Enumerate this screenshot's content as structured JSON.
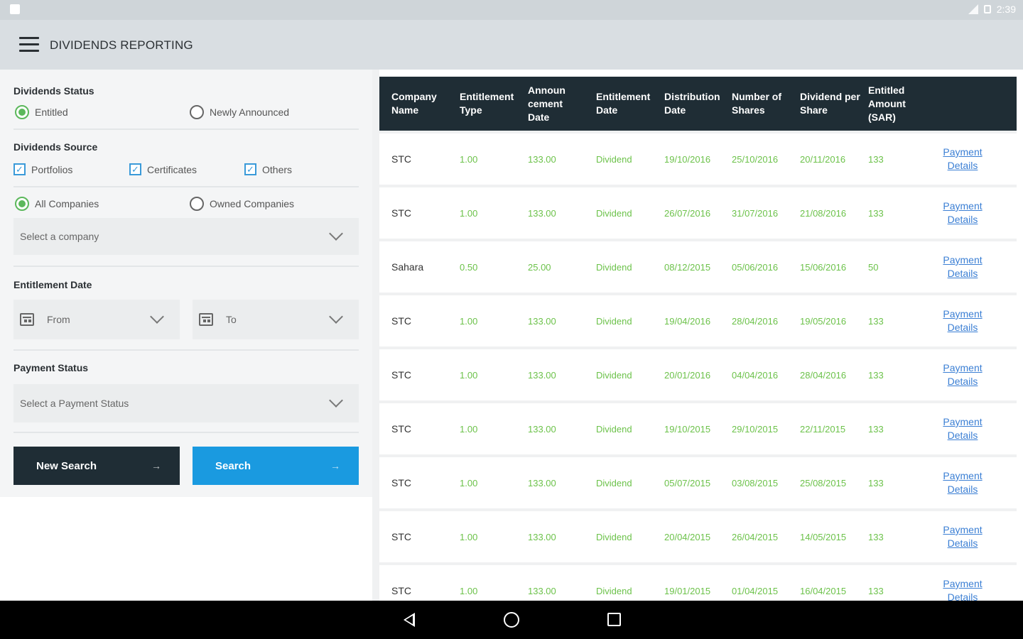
{
  "status_bar": {
    "time": "2:39"
  },
  "app_bar": {
    "title": "DIVIDENDS REPORTING"
  },
  "filters": {
    "dividends_status": {
      "title": "Dividends Status",
      "options": [
        {
          "label": "Entitled",
          "selected": true
        },
        {
          "label": "Newly Announced",
          "selected": false
        }
      ]
    },
    "dividends_source": {
      "title": "Dividends Source",
      "options": [
        {
          "label": "Portfolios",
          "checked": true
        },
        {
          "label": "Certificates",
          "checked": true
        },
        {
          "label": "Others",
          "checked": true
        }
      ]
    },
    "companies": {
      "options": [
        {
          "label": "All Companies",
          "selected": true
        },
        {
          "label": "Owned Companies",
          "selected": false
        }
      ],
      "select_placeholder": "Select a company"
    },
    "entitlement_date": {
      "title": "Entitlement Date",
      "from_placeholder": "From",
      "to_placeholder": "To"
    },
    "payment_status": {
      "title": "Payment Status",
      "select_placeholder": "Select a Payment Status"
    },
    "buttons": {
      "new_search": "New Search",
      "search": "Search",
      "arrow": "→"
    }
  },
  "table": {
    "columns": [
      "Company Name",
      "Entitlement Type",
      "Announ cement Date",
      "Entitlement Date",
      "Distribution Date",
      "Number of Shares",
      "Dividend per Share",
      "Entitled Amount (SAR)"
    ],
    "link_line1": "Payment",
    "link_line2": "Details",
    "rows": [
      [
        "STC",
        "1.00",
        "133.00",
        "Dividend",
        "19/10/2016",
        "25/10/2016",
        "20/11/2016",
        "133"
      ],
      [
        "STC",
        "1.00",
        "133.00",
        "Dividend",
        "26/07/2016",
        "31/07/2016",
        "21/08/2016",
        "133"
      ],
      [
        "Sahara",
        "0.50",
        "25.00",
        "Dividend",
        "08/12/2015",
        "05/06/2016",
        "15/06/2016",
        "50"
      ],
      [
        "STC",
        "1.00",
        "133.00",
        "Dividend",
        "19/04/2016",
        "28/04/2016",
        "19/05/2016",
        "133"
      ],
      [
        "STC",
        "1.00",
        "133.00",
        "Dividend",
        "20/01/2016",
        "04/04/2016",
        "28/04/2016",
        "133"
      ],
      [
        "STC",
        "1.00",
        "133.00",
        "Dividend",
        "19/10/2015",
        "29/10/2015",
        "22/11/2015",
        "133"
      ],
      [
        "STC",
        "1.00",
        "133.00",
        "Dividend",
        "05/07/2015",
        "03/08/2015",
        "25/08/2015",
        "133"
      ],
      [
        "STC",
        "1.00",
        "133.00",
        "Dividend",
        "20/04/2015",
        "26/04/2015",
        "14/05/2015",
        "133"
      ],
      [
        "STC",
        "1.00",
        "133.00",
        "Dividend",
        "19/01/2015",
        "01/04/2015",
        "16/04/2015",
        "133"
      ]
    ]
  },
  "colors": {
    "accent_green": "#6cc24a",
    "header_dark": "#1f2d35",
    "button_blue": "#1a9ae0",
    "link_blue": "#3b7fd4"
  }
}
